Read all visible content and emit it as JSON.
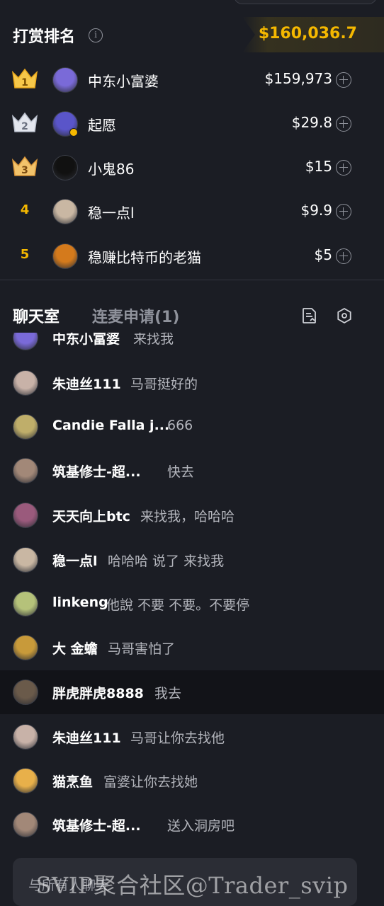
{
  "ranking": {
    "title": "打赏排名",
    "total": "$160,036.7",
    "rows": [
      {
        "rank": "1",
        "name": "中东小富婆",
        "amount": "$159,973",
        "crown": "gold",
        "avatar_color": "#7a6ad8"
      },
      {
        "rank": "2",
        "name": "起愿",
        "amount": "$29.8",
        "crown": "silver",
        "avatar_color": "#5a55c9"
      },
      {
        "rank": "3",
        "name": "小鬼86",
        "amount": "$15",
        "crown": "bronze",
        "avatar_color": "#111111"
      },
      {
        "rank": "4",
        "name": "稳一点l",
        "amount": "$9.9",
        "crown": "none",
        "avatar_color": "#c9b7a3"
      },
      {
        "rank": "5",
        "name": "稳赚比特币的老猫",
        "amount": "$5",
        "crown": "none",
        "avatar_color": "#d47a1c"
      }
    ]
  },
  "tabs": {
    "chat": "聊天室",
    "apply": "连麦申请(1)"
  },
  "chat": {
    "messages": [
      {
        "name": "中东小富婆",
        "message": "来找我",
        "avatar_color": "#7a6ad8"
      },
      {
        "name": "朱迪丝111",
        "message": "马哥挺好的",
        "avatar_color": "#c8b2a8"
      },
      {
        "name": "Candie Falla j...",
        "message": "666",
        "avatar_color": "#bfae6a"
      },
      {
        "name": "筑基修士-超...",
        "message": "快去",
        "avatar_color": "#a28878"
      },
      {
        "name": "天天向上btc",
        "message": "来找我，哈哈哈",
        "avatar_color": "#9a5a7c"
      },
      {
        "name": "稳一点l",
        "message": "哈哈哈 说了 来找我",
        "avatar_color": "#c9b7a3"
      },
      {
        "name": "linkeng",
        "message": "他說 不要 不要。不要停",
        "avatar_color": "#b5c27a"
      },
      {
        "name": "大 金蟾",
        "message": "马哥害怕了",
        "avatar_color": "#c89a3a"
      },
      {
        "name": "胖虎胖虎8888",
        "message": "我去",
        "avatar_color": "#6a5a4a"
      },
      {
        "name": "朱迪丝111",
        "message": "马哥让你去找他",
        "avatar_color": "#c8b2a8"
      },
      {
        "name": "猫烹鱼",
        "message": "富婆让你去找她",
        "avatar_color": "#e8b04a"
      },
      {
        "name": "筑基修士-超...",
        "message": "送入洞房吧",
        "avatar_color": "#a28878"
      }
    ]
  },
  "input": {
    "placeholder": "与所有人聊天"
  },
  "watermark": "SVIP聚合社区@Trader_svip",
  "colors": {
    "accent_gold": "#f5b800",
    "background": "#1b1d24",
    "muted": "#8f929b"
  }
}
